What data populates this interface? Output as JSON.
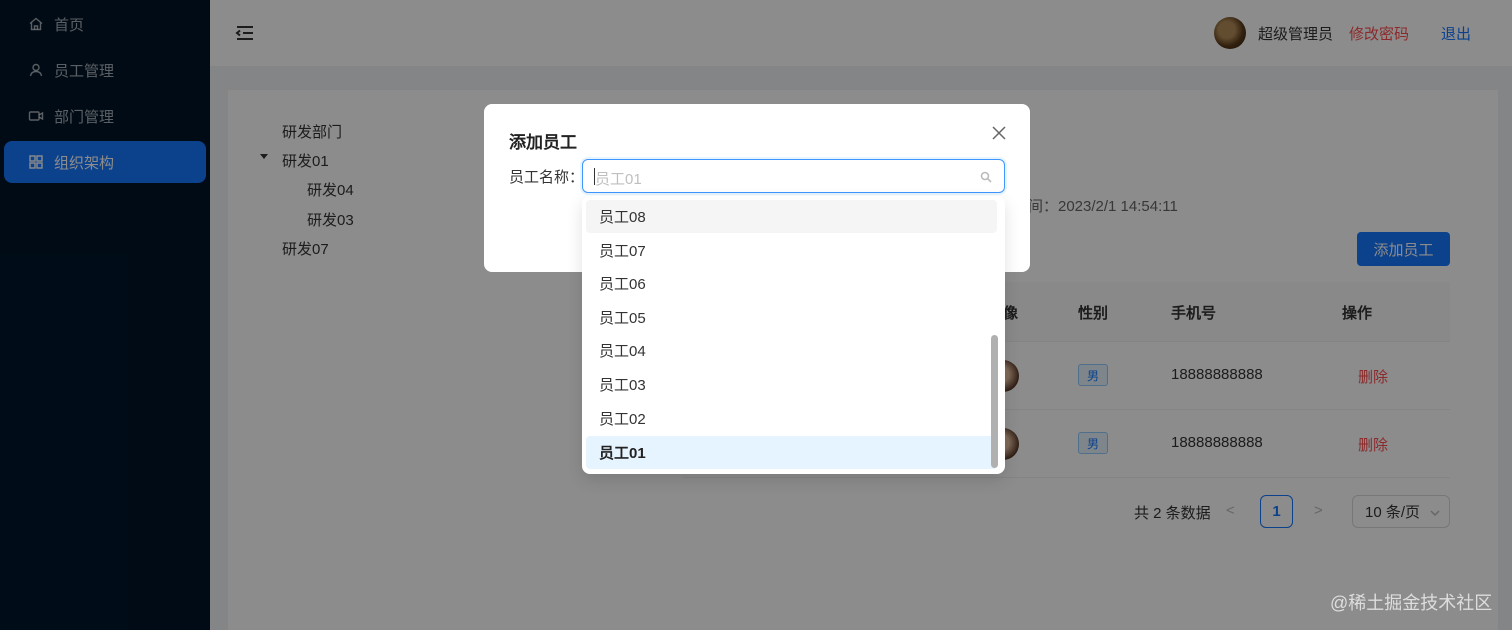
{
  "sidebar": {
    "items": [
      {
        "label": "首页",
        "icon": "home-icon",
        "active": false
      },
      {
        "label": "员工管理",
        "icon": "user-icon",
        "active": false
      },
      {
        "label": "部门管理",
        "icon": "video-icon",
        "active": false
      },
      {
        "label": "组织架构",
        "icon": "grid-icon",
        "active": true
      }
    ]
  },
  "header": {
    "user_name": "超级管理员",
    "change_password": "修改密码",
    "logout": "退出"
  },
  "tree": {
    "nodes": [
      "研发部门",
      "研发01",
      "研发04",
      "研发03",
      "研发07"
    ]
  },
  "info": {
    "created_time": "间：2023/2/1 14:54:11"
  },
  "toolbar": {
    "add_employee": "添加员工"
  },
  "table": {
    "columns": [
      "像",
      "性别",
      "手机号",
      "操作"
    ],
    "rows": [
      {
        "gender": "男",
        "phone": "18888888888",
        "action": "删除"
      },
      {
        "gender": "男",
        "phone": "18888888888",
        "action": "删除"
      }
    ]
  },
  "pagination": {
    "total": "共 2 条数据",
    "current_page": "1",
    "page_size": "10 条/页",
    "prev": "<",
    "next": ">"
  },
  "modal": {
    "title": "添加员工",
    "field_label": "员工名称：",
    "placeholder": "员工01",
    "options": [
      "员工08",
      "员工07",
      "员工06",
      "员工05",
      "员工04",
      "员工03",
      "员工02",
      "员工01"
    ],
    "selected": "员工01"
  },
  "watermark": "@稀土掘金技术社区",
  "colors": {
    "sidebar_bg": "#001529",
    "primary": "#1677ff",
    "danger": "#ff4d4f"
  }
}
